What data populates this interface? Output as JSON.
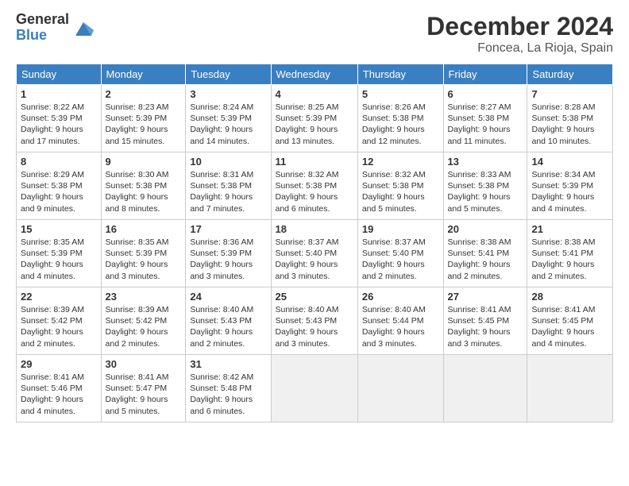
{
  "header": {
    "logo_general": "General",
    "logo_blue": "Blue",
    "month_title": "December 2024",
    "location": "Foncea, La Rioja, Spain"
  },
  "calendar": {
    "days_of_week": [
      "Sunday",
      "Monday",
      "Tuesday",
      "Wednesday",
      "Thursday",
      "Friday",
      "Saturday"
    ],
    "weeks": [
      [
        null,
        {
          "day": 2,
          "sunrise": "8:23 AM",
          "sunset": "5:39 PM",
          "daylight": "9 hours and 15 minutes."
        },
        {
          "day": 3,
          "sunrise": "8:24 AM",
          "sunset": "5:39 PM",
          "daylight": "9 hours and 14 minutes."
        },
        {
          "day": 4,
          "sunrise": "8:25 AM",
          "sunset": "5:39 PM",
          "daylight": "9 hours and 13 minutes."
        },
        {
          "day": 5,
          "sunrise": "8:26 AM",
          "sunset": "5:38 PM",
          "daylight": "9 hours and 12 minutes."
        },
        {
          "day": 6,
          "sunrise": "8:27 AM",
          "sunset": "5:38 PM",
          "daylight": "9 hours and 11 minutes."
        },
        {
          "day": 7,
          "sunrise": "8:28 AM",
          "sunset": "5:38 PM",
          "daylight": "9 hours and 10 minutes."
        }
      ],
      [
        {
          "day": 1,
          "sunrise": "8:22 AM",
          "sunset": "5:39 PM",
          "daylight": "9 hours and 17 minutes."
        },
        {
          "day": 8,
          "sunrise": "8:29 AM",
          "sunset": "5:38 PM",
          "daylight": "9 hours and 9 minutes."
        },
        {
          "day": 9,
          "sunrise": "8:30 AM",
          "sunset": "5:38 PM",
          "daylight": "9 hours and 8 minutes."
        },
        {
          "day": 10,
          "sunrise": "8:31 AM",
          "sunset": "5:38 PM",
          "daylight": "9 hours and 7 minutes."
        },
        {
          "day": 11,
          "sunrise": "8:32 AM",
          "sunset": "5:38 PM",
          "daylight": "9 hours and 6 minutes."
        },
        {
          "day": 12,
          "sunrise": "8:32 AM",
          "sunset": "5:38 PM",
          "daylight": "9 hours and 5 minutes."
        },
        {
          "day": 13,
          "sunrise": "8:33 AM",
          "sunset": "5:38 PM",
          "daylight": "9 hours and 5 minutes."
        },
        {
          "day": 14,
          "sunrise": "8:34 AM",
          "sunset": "5:39 PM",
          "daylight": "9 hours and 4 minutes."
        }
      ],
      [
        {
          "day": 15,
          "sunrise": "8:35 AM",
          "sunset": "5:39 PM",
          "daylight": "9 hours and 4 minutes."
        },
        {
          "day": 16,
          "sunrise": "8:35 AM",
          "sunset": "5:39 PM",
          "daylight": "9 hours and 3 minutes."
        },
        {
          "day": 17,
          "sunrise": "8:36 AM",
          "sunset": "5:39 PM",
          "daylight": "9 hours and 3 minutes."
        },
        {
          "day": 18,
          "sunrise": "8:37 AM",
          "sunset": "5:40 PM",
          "daylight": "9 hours and 3 minutes."
        },
        {
          "day": 19,
          "sunrise": "8:37 AM",
          "sunset": "5:40 PM",
          "daylight": "9 hours and 2 minutes."
        },
        {
          "day": 20,
          "sunrise": "8:38 AM",
          "sunset": "5:41 PM",
          "daylight": "9 hours and 2 minutes."
        },
        {
          "day": 21,
          "sunrise": "8:38 AM",
          "sunset": "5:41 PM",
          "daylight": "9 hours and 2 minutes."
        }
      ],
      [
        {
          "day": 22,
          "sunrise": "8:39 AM",
          "sunset": "5:42 PM",
          "daylight": "9 hours and 2 minutes."
        },
        {
          "day": 23,
          "sunrise": "8:39 AM",
          "sunset": "5:42 PM",
          "daylight": "9 hours and 2 minutes."
        },
        {
          "day": 24,
          "sunrise": "8:40 AM",
          "sunset": "5:43 PM",
          "daylight": "9 hours and 2 minutes."
        },
        {
          "day": 25,
          "sunrise": "8:40 AM",
          "sunset": "5:43 PM",
          "daylight": "9 hours and 3 minutes."
        },
        {
          "day": 26,
          "sunrise": "8:40 AM",
          "sunset": "5:44 PM",
          "daylight": "9 hours and 3 minutes."
        },
        {
          "day": 27,
          "sunrise": "8:41 AM",
          "sunset": "5:45 PM",
          "daylight": "9 hours and 3 minutes."
        },
        {
          "day": 28,
          "sunrise": "8:41 AM",
          "sunset": "5:45 PM",
          "daylight": "9 hours and 4 minutes."
        }
      ],
      [
        {
          "day": 29,
          "sunrise": "8:41 AM",
          "sunset": "5:46 PM",
          "daylight": "9 hours and 4 minutes."
        },
        {
          "day": 30,
          "sunrise": "8:41 AM",
          "sunset": "5:47 PM",
          "daylight": "9 hours and 5 minutes."
        },
        {
          "day": 31,
          "sunrise": "8:42 AM",
          "sunset": "5:48 PM",
          "daylight": "9 hours and 6 minutes."
        },
        null,
        null,
        null,
        null
      ]
    ]
  }
}
